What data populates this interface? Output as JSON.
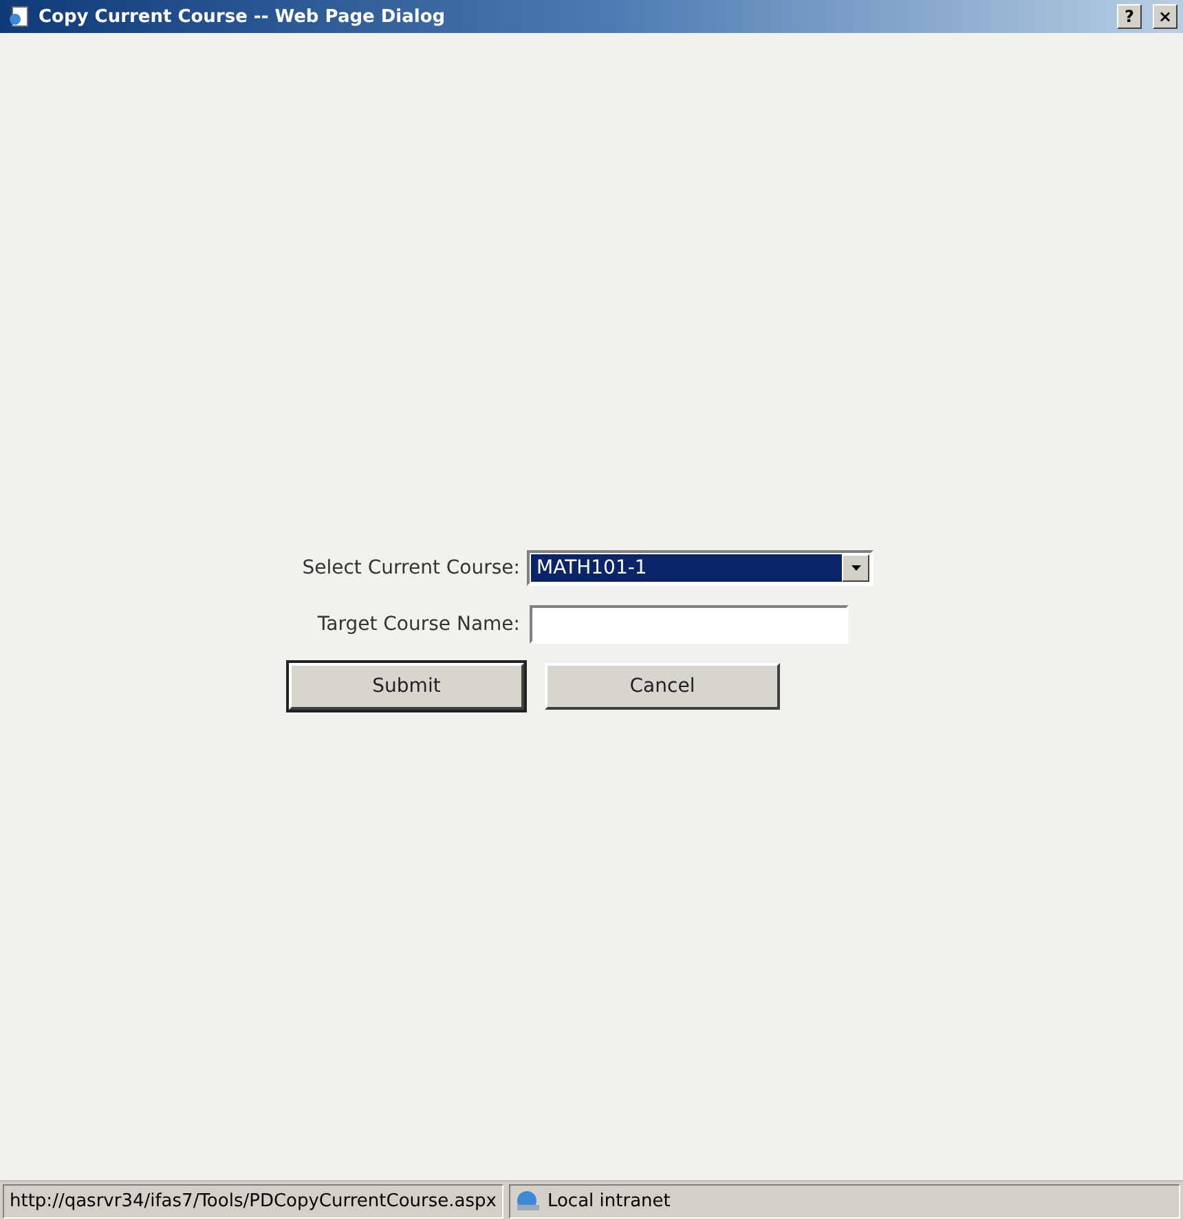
{
  "window": {
    "title": "Copy Current Course -- Web Page Dialog",
    "help_button": "?",
    "close_button": "×"
  },
  "form": {
    "course_label": "Select Current Course:",
    "course_value": "MATH101-1",
    "target_label": "Target Course Name:",
    "buttons": [
      {
        "label": "Submit",
        "default": true
      },
      {
        "label": "Cancel",
        "default": false
      }
    ]
  },
  "status_bar": {
    "url": "http://qasrvr34/ifas7/Tools/PDCopyCurrentCourse.aspx",
    "zone": "Local intranet"
  }
}
